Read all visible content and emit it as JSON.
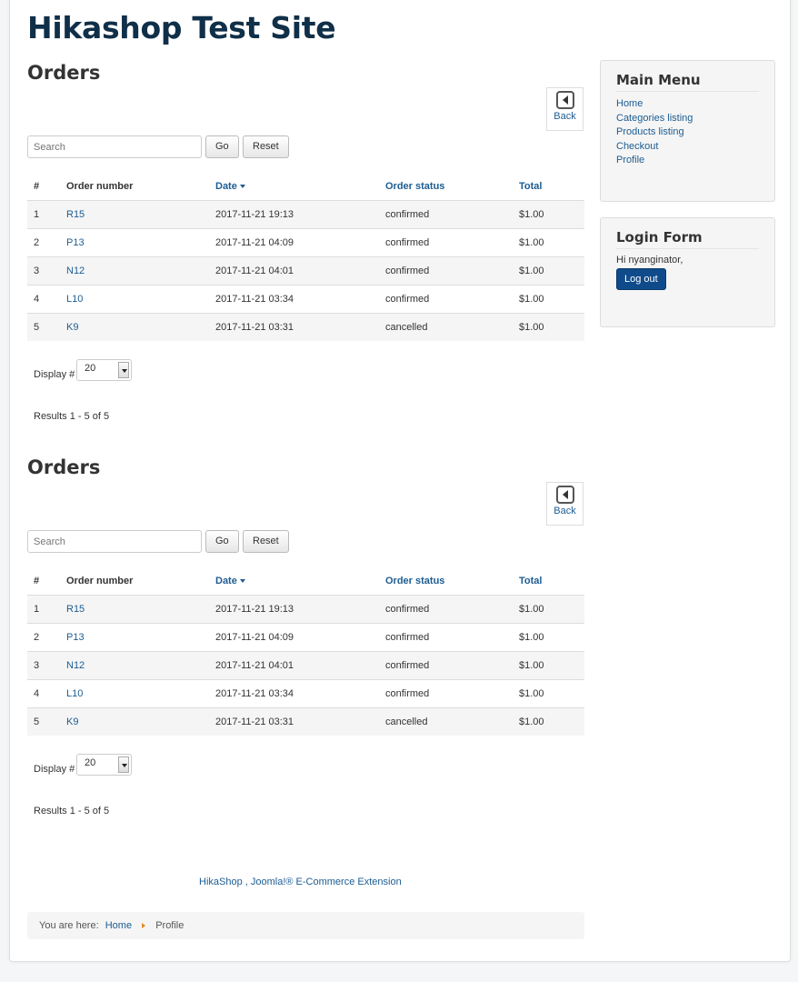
{
  "site_title": "Hikashop Test Site",
  "orders_sections": [
    {
      "title": "Orders",
      "back_label": "Back",
      "search_placeholder": "Search",
      "go_label": "Go",
      "reset_label": "Reset",
      "columns": [
        "#",
        "Order number",
        "Date",
        "Order status",
        "Total"
      ],
      "rows": [
        {
          "num": "1",
          "order": "R15",
          "date": "2017-11-21 19:13",
          "status": "confirmed",
          "total": "$1.00"
        },
        {
          "num": "2",
          "order": "P13",
          "date": "2017-11-21 04:09",
          "status": "confirmed",
          "total": "$1.00"
        },
        {
          "num": "3",
          "order": "N12",
          "date": "2017-11-21 04:01",
          "status": "confirmed",
          "total": "$1.00"
        },
        {
          "num": "4",
          "order": "L10",
          "date": "2017-11-21 03:34",
          "status": "confirmed",
          "total": "$1.00"
        },
        {
          "num": "5",
          "order": "K9",
          "date": "2017-11-21 03:31",
          "status": "cancelled",
          "total": "$1.00"
        }
      ],
      "display_label": "Display #",
      "display_value": "20",
      "results_text": "Results 1 - 5 of 5"
    },
    {
      "title": "Orders",
      "back_label": "Back",
      "search_placeholder": "Search",
      "go_label": "Go",
      "reset_label": "Reset",
      "columns": [
        "#",
        "Order number",
        "Date",
        "Order status",
        "Total"
      ],
      "rows": [
        {
          "num": "1",
          "order": "R15",
          "date": "2017-11-21 19:13",
          "status": "confirmed",
          "total": "$1.00"
        },
        {
          "num": "2",
          "order": "P13",
          "date": "2017-11-21 04:09",
          "status": "confirmed",
          "total": "$1.00"
        },
        {
          "num": "3",
          "order": "N12",
          "date": "2017-11-21 04:01",
          "status": "confirmed",
          "total": "$1.00"
        },
        {
          "num": "4",
          "order": "L10",
          "date": "2017-11-21 03:34",
          "status": "confirmed",
          "total": "$1.00"
        },
        {
          "num": "5",
          "order": "K9",
          "date": "2017-11-21 03:31",
          "status": "cancelled",
          "total": "$1.00"
        }
      ],
      "display_label": "Display #",
      "display_value": "20",
      "results_text": "Results 1 - 5 of 5"
    }
  ],
  "footer": {
    "text": "HikaShop , Joomla!® E-Commerce Extension"
  },
  "breadcrumb": {
    "prefix": "You are here:",
    "home": "Home",
    "current": "Profile"
  },
  "main_menu": {
    "title": "Main Menu",
    "items": [
      "Home",
      "Categories listing",
      "Products listing",
      "Checkout",
      "Profile"
    ]
  },
  "login_form": {
    "title": "Login Form",
    "greeting": "Hi nyanginator,",
    "logout_label": "Log out"
  },
  "colors": {
    "link": "#1c5c92",
    "title": "#102f48",
    "primary_button": "#0f4b8a",
    "breadcrumb_separator": "#e88a1a"
  }
}
